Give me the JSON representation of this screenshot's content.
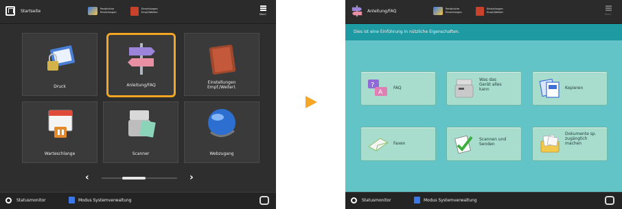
{
  "left_screen": {
    "home_title": "Startseite",
    "shortcut1": {
      "line1": "Persönliche",
      "line2": "Einstellungen"
    },
    "shortcut2": {
      "line1": "Einstellungen",
      "line2": "Empf./Weiterl."
    },
    "menu_label": "Menü",
    "tiles": [
      {
        "label": "Druck",
        "icon": "printer-lock-icon"
      },
      {
        "label": "Anleitung/FAQ",
        "icon": "signpost-icon",
        "selected": true
      },
      {
        "label": "Einstellungen Empf./Weiterl.",
        "icon": "book-icon"
      },
      {
        "label": "Warteschlange",
        "icon": "calendar-queue-icon"
      },
      {
        "label": "Scanner",
        "icon": "scanner-icon"
      },
      {
        "label": "Webzugang",
        "icon": "globe-icon"
      }
    ],
    "prev_symbol": "‹",
    "next_symbol": "›",
    "status_monitor": "Statusmonitor",
    "system_mode": "Modus Systemverwaltung"
  },
  "arrow_color": "#f5a623",
  "right_screen": {
    "title": "Anleitung/FAQ",
    "shortcut1": {
      "line1": "Persönliche",
      "line2": "Einstellungen"
    },
    "shortcut2": {
      "line1": "Einstellungen",
      "line2": "Empf./Weiterl."
    },
    "menu_label": "Menü",
    "intro_text": "Dies ist eine Einführung in nützliche Eigenschaften.",
    "buttons": [
      {
        "label": "FAQ",
        "icon": "faq-icon"
      },
      {
        "label": "Was das\nGerät alles\nkann",
        "icon": "device-icon"
      },
      {
        "label": "Kopieren",
        "icon": "copy-icon"
      },
      {
        "label": "Faxen",
        "icon": "fax-icon"
      },
      {
        "label": "Scannen und\nSenden",
        "icon": "scan-send-icon"
      },
      {
        "label": "Dokumente sp.\nzugänglich\nmachen",
        "icon": "documents-icon"
      }
    ],
    "status_monitor": "Statusmonitor",
    "system_mode": "Modus Systemverwaltung"
  },
  "colors": {
    "selection_border": "#f4a522",
    "intro_bar": "#1e9aa3",
    "content_bg": "#63c4c7",
    "button_bg": "#a8dccd"
  }
}
